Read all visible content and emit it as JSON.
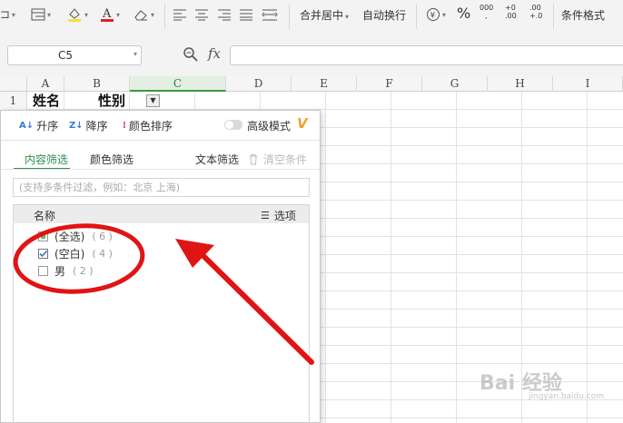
{
  "ribbon": {
    "merge_center": "合并居中",
    "auto_wrap": "自动换行",
    "cond_format": "条件格式",
    "percent": "%",
    "thousands": "000",
    "dec_increase": "+0 .00",
    "dec_decrease": ".00 +.0"
  },
  "formula_bar": {
    "name_box": "C5",
    "fx": "fx",
    "formula": ""
  },
  "grid": {
    "columns": [
      "A",
      "B",
      "C",
      "D",
      "E",
      "F",
      "G",
      "H",
      "I"
    ],
    "rows": [
      "1"
    ],
    "cells": {
      "A1": "姓名",
      "B1": "性别"
    }
  },
  "filter_panel": {
    "sort_asc": "升序",
    "sort_desc": "降序",
    "color_sort": "颜色排序",
    "advanced_mode": "高级模式",
    "tab_content": "内容筛选",
    "tab_color": "颜色筛选",
    "text_filter": "文本筛选",
    "clear_conditions": "清空条件",
    "search_placeholder": "(支持多条件过滤，例如：北京 上海)",
    "list_header_name": "名称",
    "list_header_options": "选项",
    "items": [
      {
        "label": "(全选)",
        "count": "( 6 )",
        "state": "partial"
      },
      {
        "label": "(空白)",
        "count": "( 4 )",
        "state": "checked"
      },
      {
        "label": "男",
        "count": "( 2 )",
        "state": "unchecked"
      }
    ]
  },
  "watermark": {
    "logo": "Bai 经验",
    "sub": "jingyan.baidu.com"
  },
  "colors": {
    "accent_green": "#2f8f4e",
    "annotation_red": "#e01414"
  }
}
